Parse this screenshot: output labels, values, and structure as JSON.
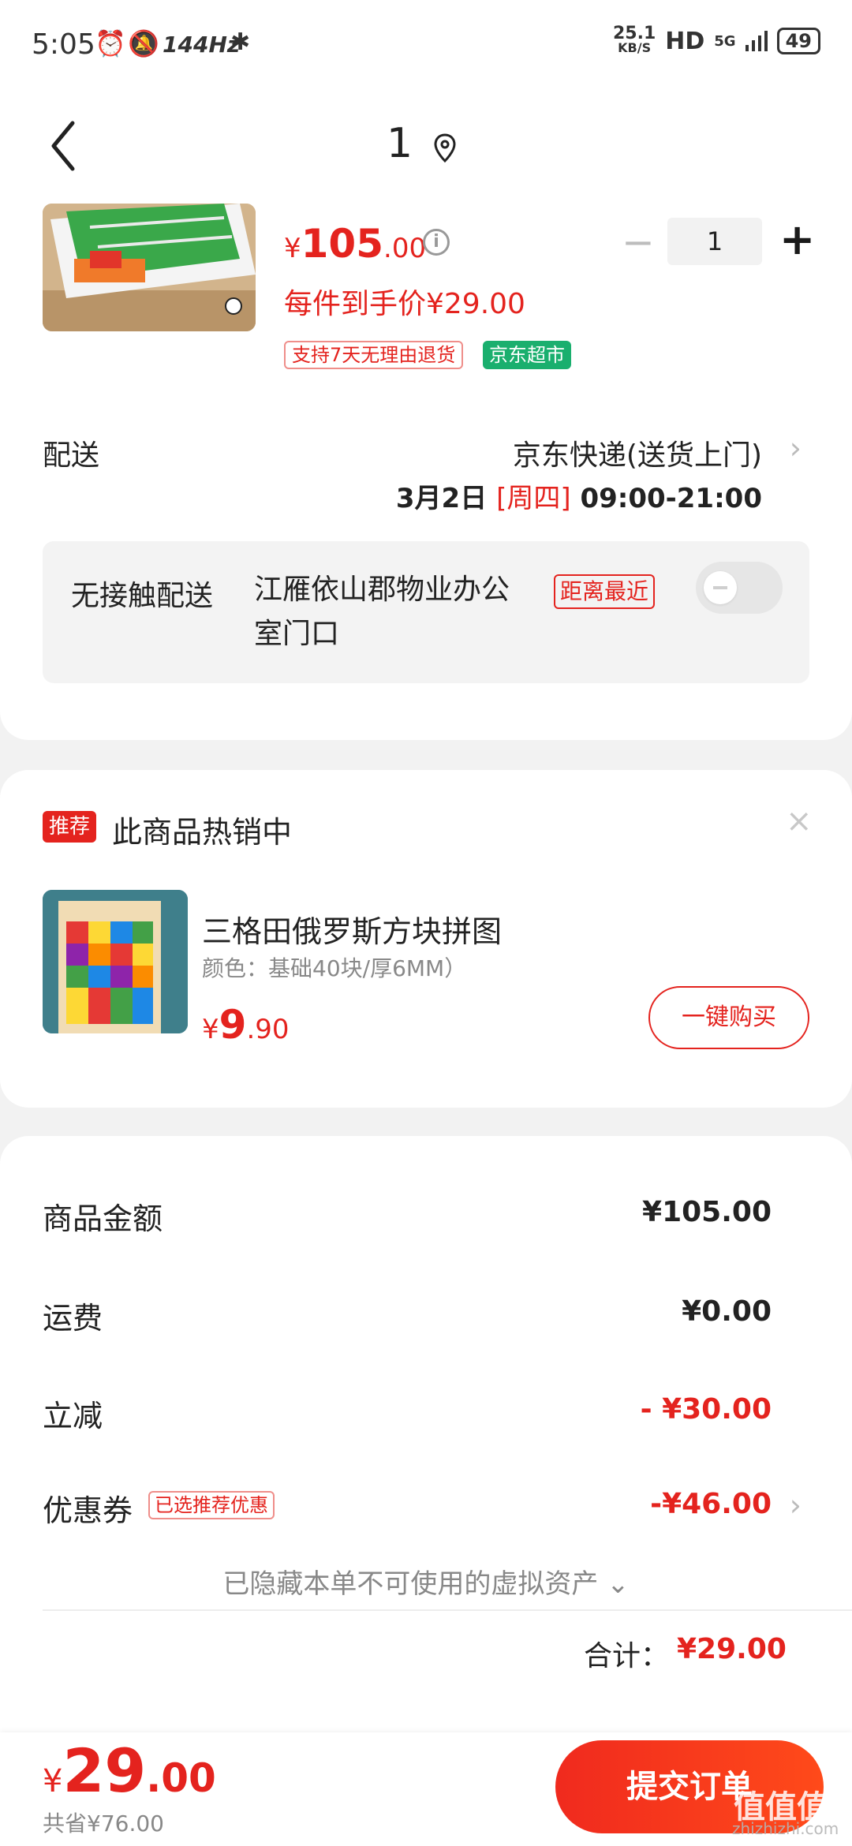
{
  "status_bar": {
    "time": "5:05",
    "refresh": "144Hz",
    "net_speed": "25.1",
    "net_unit": "KB/S",
    "hd": "HD",
    "network": "5G",
    "battery": "49"
  },
  "header": {
    "title": "1"
  },
  "product": {
    "price_symbol": "¥",
    "price_int": "105",
    "price_dec": ".00",
    "unit_price": "每件到手价¥29.00",
    "quantity": "1",
    "minus": "−",
    "plus": "+",
    "tag_return": "支持7天无理由退货",
    "tag_market": "京东超市"
  },
  "shipping": {
    "label": "配送",
    "method": "京东快递(送货上门)",
    "date": "3月2日",
    "weekday": "[周四]",
    "window": "09:00-21:00"
  },
  "contactless": {
    "label": "无接触配送",
    "address": "江雁依山郡物业办公室门口",
    "tag": "距离最近",
    "enabled": false
  },
  "recommendation": {
    "badge": "推荐",
    "title": "此商品热销中",
    "close": "×",
    "name": "三格田俄罗斯方块拼图",
    "spec": "颜色：基础40块/厚6MM）",
    "price_symbol": "¥",
    "price_int": "9",
    "price_dec": ".90",
    "buy_label": "一键购买"
  },
  "summary": {
    "goods_label": "商品金额",
    "goods_value": "¥105.00",
    "freight_label": "运费",
    "freight_value": "¥0.00",
    "discount_label": "立减",
    "discount_value": "- ¥30.00",
    "coupon_label": "优惠券",
    "coupon_tag": "已选推荐优惠",
    "coupon_value": "-¥46.00",
    "hidden_note": "已隐藏本单不可使用的虚拟资产 ⌄",
    "total_label": "合计：",
    "total_value": "¥29.00"
  },
  "bottom": {
    "price_symbol": "¥",
    "price_int": "29",
    "price_dec": ".00",
    "saved": "共省¥76.00",
    "submit": "提交订单",
    "watermark": "值值值",
    "watermark_sub": "zhizhizhi.com"
  },
  "colors": {
    "accent": "#e4231e",
    "green_tag": "#1aaf6e"
  }
}
